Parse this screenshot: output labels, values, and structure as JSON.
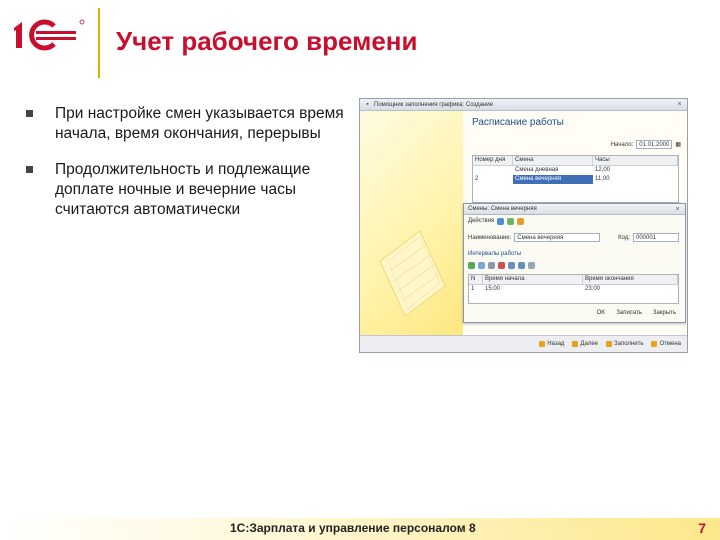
{
  "header": {
    "title": "Учет рабочего времени",
    "brand_color": "#c8102e",
    "accent_color": "#e0b000",
    "logo": "1c-logo"
  },
  "bullets": [
    "При настройке смен указывается время начала, время окончания, перерывы",
    "Продолжительность и подлежащие доплате ночные и вечерние часы считаются автоматически"
  ],
  "screenshot": {
    "window_title": "Помощник заполнения графика: Создание",
    "wizard_title": "Расписание работы",
    "start_label": "Начало:",
    "start_value": "01.01.2000",
    "grid_headers": [
      "Номер дня",
      "Смена",
      "Часы"
    ],
    "grid_rows": [
      {
        "day": "",
        "shift": "Смена дневная",
        "hours": "12,00"
      },
      {
        "day": "2",
        "shift": "Смена вечерняя",
        "hours": "11,00"
      }
    ],
    "dialog": {
      "title": "Смены: Смена вечерняя",
      "actions_label": "Действия",
      "name_label": "Наименование:",
      "name_value": "Смена вечерняя",
      "code_label": "Код:",
      "code_value": "000001",
      "section_label": "Интервалы работы",
      "grid_headers": [
        "N",
        "Время начала",
        "Время окончания"
      ],
      "grid_row": {
        "n": "1",
        "start": "15:00",
        "end": "23:00"
      },
      "buttons": [
        "OK",
        "Записать",
        "Закрыть"
      ]
    },
    "footer_buttons": [
      "Назад",
      "Далее",
      "Заполнить",
      "Отмена"
    ]
  },
  "footer": {
    "caption": "1С:Зарплата и управление персоналом 8",
    "page_number": "7"
  }
}
